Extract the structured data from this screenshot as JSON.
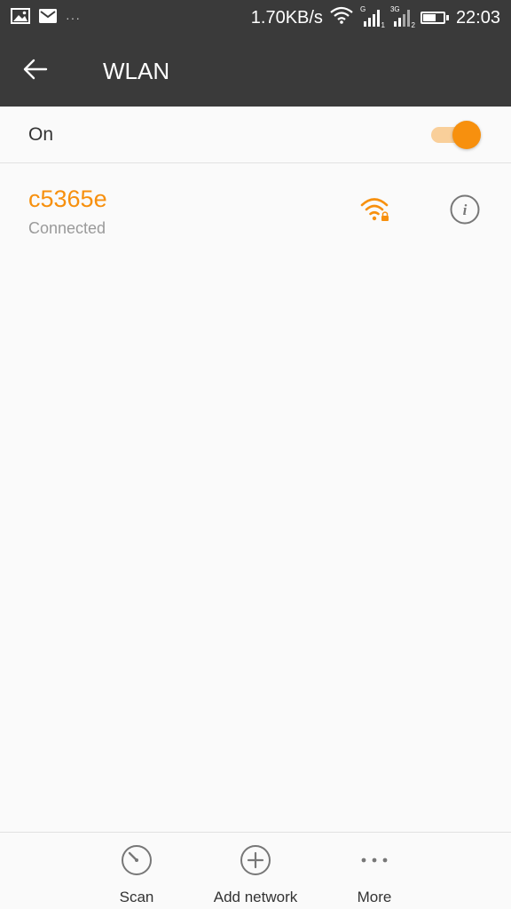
{
  "status_bar": {
    "notification_icons": [
      "image-icon",
      "mail-icon"
    ],
    "overflow": "···",
    "speed": "1.70KB/s",
    "sim1_tag": "G",
    "sim1_sub": "1",
    "sim2_tag": "3G",
    "sim2_sub": "2",
    "battery_level": 0.65,
    "time": "22:03"
  },
  "app_bar": {
    "title": "WLAN",
    "back_icon": "arrow-left-icon"
  },
  "toggle": {
    "label": "On",
    "state": true,
    "accent_color": "#f7900e"
  },
  "networks": [
    {
      "ssid": "c5365e",
      "status": "Connected",
      "secured": true,
      "signal_bars": 3
    }
  ],
  "bottom_bar": {
    "scan_label": "Scan",
    "add_label": "Add network",
    "more_label": "More"
  },
  "colors": {
    "accent": "#f7900e",
    "bar_bg": "#3a3a3a",
    "bg": "#fafafa"
  }
}
